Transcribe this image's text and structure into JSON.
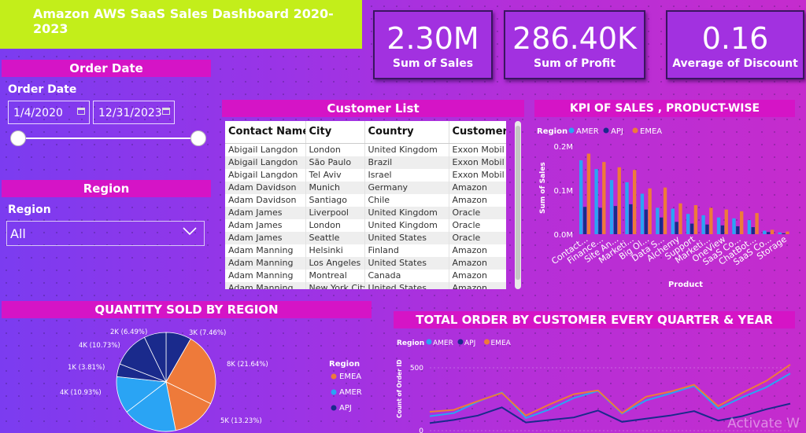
{
  "header": {
    "title": "Amazon AWS SaaS Sales Dashboard 2020-2023"
  },
  "kpis": [
    {
      "value": "2.30M",
      "label": "Sum of Sales"
    },
    {
      "value": "286.40K",
      "label": "Sum of Profit"
    },
    {
      "value": "0.16",
      "label": "Average of Discount"
    }
  ],
  "order_date": {
    "panel_title": "Order Date",
    "label": "Order Date",
    "start": "1/4/2020",
    "end": "12/31/2023"
  },
  "region_filter": {
    "panel_title": "Region",
    "label": "Region",
    "selected": "All"
  },
  "customer_list": {
    "title": "Customer List",
    "columns": [
      "Contact Name",
      "City",
      "Country",
      "Customer"
    ],
    "rows": [
      [
        "Abigail Langdon",
        "London",
        "United Kingdom",
        "Exxon Mobil"
      ],
      [
        "Abigail Langdon",
        "São Paulo",
        "Brazil",
        "Exxon Mobil"
      ],
      [
        "Abigail Langdon",
        "Tel Aviv",
        "Israel",
        "Exxon Mobil"
      ],
      [
        "Adam Davidson",
        "Munich",
        "Germany",
        "Amazon"
      ],
      [
        "Adam Davidson",
        "Santiago",
        "Chile",
        "Amazon"
      ],
      [
        "Adam James",
        "Liverpool",
        "United Kingdom",
        "Oracle"
      ],
      [
        "Adam James",
        "London",
        "United Kingdom",
        "Oracle"
      ],
      [
        "Adam James",
        "Seattle",
        "United States",
        "Oracle"
      ],
      [
        "Adam Manning",
        "Helsinki",
        "Finland",
        "Amazon"
      ],
      [
        "Adam Manning",
        "Los Angeles",
        "United States",
        "Amazon"
      ],
      [
        "Adam Manning",
        "Montreal",
        "Canada",
        "Amazon"
      ],
      [
        "Adam Manning",
        "New York City",
        "United States",
        "Amazon"
      ]
    ]
  },
  "colors": {
    "amer": "#2aa4f4",
    "apj": "#1a2a8c",
    "emea": "#ee7a3a",
    "accent": "#d514c6",
    "title_bg": "#c3ee1a"
  },
  "watermark": "Activate W",
  "chart_data": [
    {
      "type": "bar",
      "title": "KPI OF SALES , PRODUCT-WISE",
      "legend_title": "Region",
      "xlabel": "Product",
      "ylabel": "Sum of Sales",
      "ylim": [
        0,
        200000
      ],
      "yticks": [
        "0.0M",
        "0.1M",
        "0.2M"
      ],
      "categories": [
        "Contact...",
        "Finance...",
        "Site An...",
        "Marketi...",
        "Big Ol...",
        "Data S...",
        "Alchemy",
        "Support",
        "Marketi...",
        "OneView",
        "SaaS Co...",
        "ChatBot...",
        "SaaS Co...",
        "Storage"
      ],
      "series": [
        {
          "name": "AMER",
          "values": [
            168000,
            148000,
            123000,
            118000,
            92000,
            60000,
            58000,
            46000,
            43000,
            38000,
            36000,
            32000,
            8000,
            4000
          ]
        },
        {
          "name": "APJ",
          "values": [
            62000,
            60000,
            64000,
            68000,
            56000,
            38000,
            28000,
            24000,
            22000,
            20000,
            18000,
            16000,
            5000,
            2000
          ]
        },
        {
          "name": "EMEA",
          "values": [
            183000,
            164000,
            152000,
            146000,
            104000,
            106000,
            70000,
            66000,
            60000,
            56000,
            52000,
            48000,
            10000,
            6000
          ]
        }
      ],
      "legend_position": "top-left",
      "grid": false
    },
    {
      "type": "pie",
      "title": "QUANTITY SOLD BY REGION",
      "legend_title": "Region",
      "slices": [
        {
          "label": "3K (7.46%)",
          "value": 7.46,
          "color": "#1a2a8c"
        },
        {
          "label": "8K (21.64%)",
          "value": 21.64,
          "color": "#ee7a3a"
        },
        {
          "label": "5K (13.23%)",
          "value": 13.23,
          "color": "#ee7a3a"
        },
        {
          "label": "",
          "value": 16.0,
          "color": "#2aa4f4"
        },
        {
          "label": "4K (10.93%)",
          "value": 10.93,
          "color": "#2aa4f4"
        },
        {
          "label": "1K (3.81%)",
          "value": 3.81,
          "color": "#1a2a8c"
        },
        {
          "label": "4K (10.73%)",
          "value": 10.73,
          "color": "#1a2a8c"
        },
        {
          "label": "2K (6.49%)",
          "value": 6.49,
          "color": "#1a2a8c"
        }
      ],
      "legend": [
        "EMEA",
        "AMER",
        "APJ"
      ]
    },
    {
      "type": "line",
      "title": "TOTAL ORDER BY CUSTOMER EVERY QUARTER & YEAR",
      "legend_title": "Region",
      "ylabel": "Count of Order ID",
      "ylim": [
        0,
        560
      ],
      "yticks": [
        0,
        500
      ],
      "x": [
        1,
        2,
        3,
        4,
        5,
        6,
        7,
        8,
        9,
        10,
        11,
        12,
        13,
        14,
        15,
        16
      ],
      "series": [
        {
          "name": "AMER",
          "values": [
            115,
            140,
            230,
            305,
            100,
            170,
            260,
            315,
            135,
            240,
            295,
            355,
            175,
            265,
            345,
            455
          ]
        },
        {
          "name": "APJ",
          "values": [
            60,
            85,
            120,
            185,
            65,
            85,
            105,
            160,
            70,
            95,
            120,
            155,
            80,
            115,
            170,
            215
          ]
        },
        {
          "name": "EMEA",
          "values": [
            150,
            165,
            235,
            300,
            120,
            210,
            290,
            320,
            140,
            270,
            310,
            365,
            195,
            300,
            395,
            525
          ]
        }
      ]
    }
  ]
}
